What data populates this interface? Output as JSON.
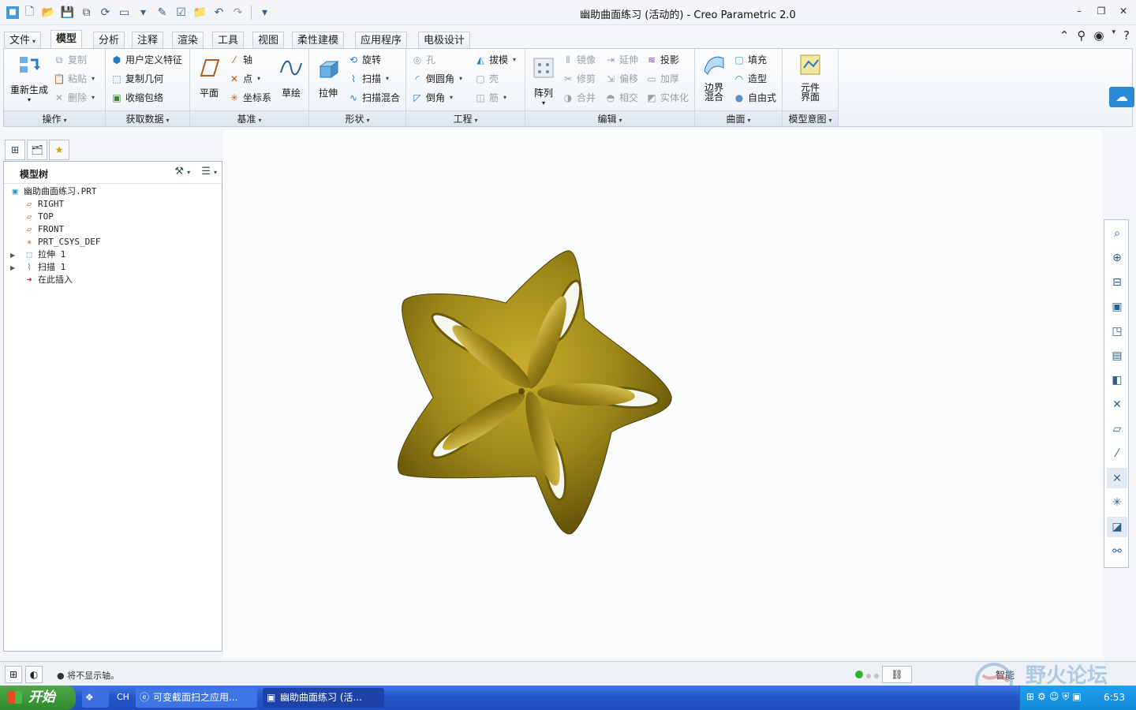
{
  "window": {
    "title": "幽助曲面练习 (活动的) - Creo Parametric 2.0"
  },
  "menu_tabs": [
    {
      "label": "文件",
      "has_dropdown": true
    },
    {
      "label": "模型"
    },
    {
      "label": "分析"
    },
    {
      "label": "注释"
    },
    {
      "label": "渲染"
    },
    {
      "label": "工具"
    },
    {
      "label": "视图"
    },
    {
      "label": "柔性建模"
    },
    {
      "label": "应用程序"
    },
    {
      "label": "电极设计"
    }
  ],
  "active_tab": "模型",
  "ribbon": {
    "operations": {
      "label": "操作",
      "regenerate": "重新生成",
      "copy": "复制",
      "paste": "粘贴",
      "delete": "删除"
    },
    "get_data": {
      "label": "获取数据",
      "udf": "用户定义特征",
      "copy_geom": "复制几何",
      "shrinkwrap": "收缩包络"
    },
    "datum": {
      "label": "基准",
      "plane": "平面",
      "axis": "轴",
      "point": "点",
      "csys": "坐标系",
      "sketch": "草绘"
    },
    "shapes": {
      "label": "形状",
      "extrude": "拉伸",
      "revolve": "旋转",
      "sweep": "扫描",
      "swept_blend": "扫描混合"
    },
    "engineering": {
      "label": "工程",
      "hole": "孔",
      "round": "倒圆角",
      "chamfer": "倒角",
      "draft": "拔模",
      "shell": "壳",
      "rib": "筋"
    },
    "editing": {
      "label": "编辑",
      "pattern": "阵列",
      "mirror": "镜像",
      "trim": "修剪",
      "merge": "合并",
      "extend": "延伸",
      "offset": "偏移",
      "intersect": "相交",
      "project": "投影",
      "thicken": "加厚",
      "solidify": "实体化"
    },
    "surfaces": {
      "label": "曲面",
      "boundary_blend": "边界\n混合",
      "boundary_blend_l1": "边界",
      "boundary_blend_l2": "混合",
      "fill": "填充",
      "style": "造型",
      "freestyle": "自由式"
    },
    "model_intent": {
      "label": "模型意图",
      "component_interface_l1": "元件",
      "component_interface_l2": "界面"
    }
  },
  "model_tree": {
    "title": "模型树",
    "nodes": [
      {
        "label": "幽助曲面练习.PRT",
        "icon": "part-icon"
      },
      {
        "label": "RIGHT",
        "icon": "datum-plane-icon"
      },
      {
        "label": "TOP",
        "icon": "datum-plane-icon"
      },
      {
        "label": "FRONT",
        "icon": "datum-plane-icon"
      },
      {
        "label": "PRT_CSYS_DEF",
        "icon": "csys-icon"
      },
      {
        "label": "拉伸 1",
        "icon": "extrude-icon",
        "expandable": true
      },
      {
        "label": "扫描 1",
        "icon": "sweep-icon",
        "expandable": true
      },
      {
        "label": "在此插入",
        "icon": "insert-here-arrow-icon"
      }
    ]
  },
  "status": {
    "message": "将不显示轴。",
    "filter": "智能"
  },
  "taskbar": {
    "start": "开始",
    "lang": "CH",
    "items": [
      {
        "label": "可变截面扫之应用..."
      },
      {
        "label": "幽助曲面练习 (活..."
      }
    ],
    "clock": "6:53"
  },
  "watermark": "野火论坛",
  "colors": {
    "model_gold": "#9c8618",
    "ribbon_bg": "#eef2f7",
    "taskbar_blue": "#2556c9"
  }
}
